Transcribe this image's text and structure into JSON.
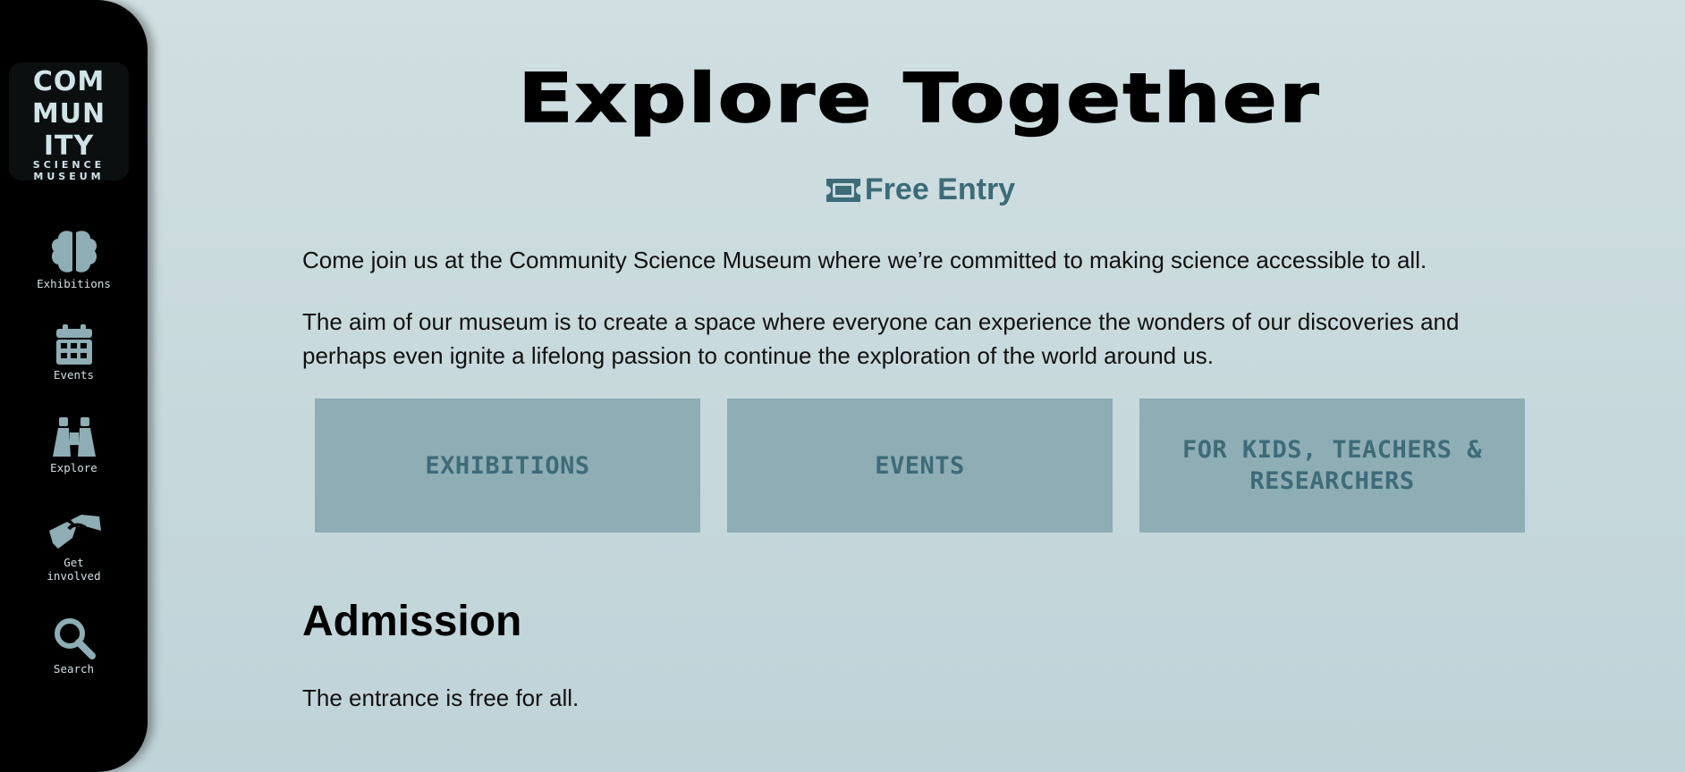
{
  "sidebar": {
    "logo": {
      "line1": "COM",
      "line2": "MUN",
      "line3": "ITY",
      "line4": "SCIENCE",
      "line5": "MUSEUM"
    },
    "items": [
      {
        "label": "Exhibitions",
        "icon": "brain-icon"
      },
      {
        "label": "Events",
        "icon": "calendar-icon"
      },
      {
        "label": "Explore",
        "icon": "binoculars-icon"
      },
      {
        "label_line1": "Get",
        "label_line2": "involved",
        "icon": "handshake-icon"
      },
      {
        "label": "Search",
        "icon": "search-icon"
      }
    ]
  },
  "main": {
    "title": "Explore Together",
    "badge": {
      "label": "Free Entry",
      "icon": "ticket-icon"
    },
    "intro": "Come join us at the Community Science Museum where we’re committed to making science accessible to all.",
    "aim": "The aim of our museum is to create a space where everyone can experience the wonders of our discoveries and perhaps even ignite a lifelong passion to continue the exploration of the world around us.",
    "cards": [
      {
        "label": "EXHIBITIONS"
      },
      {
        "label": "EVENTS"
      },
      {
        "label": "FOR KIDS, TEACHERS & RESEARCHERS"
      }
    ],
    "admission": {
      "heading": "Admission",
      "text": "The entrance is free for all."
    }
  },
  "colors": {
    "background": "#c8dadd",
    "sidebar": "#000000",
    "accent": "#3d6b78",
    "card": "#8eadb4",
    "icon": "#8eadb4"
  }
}
